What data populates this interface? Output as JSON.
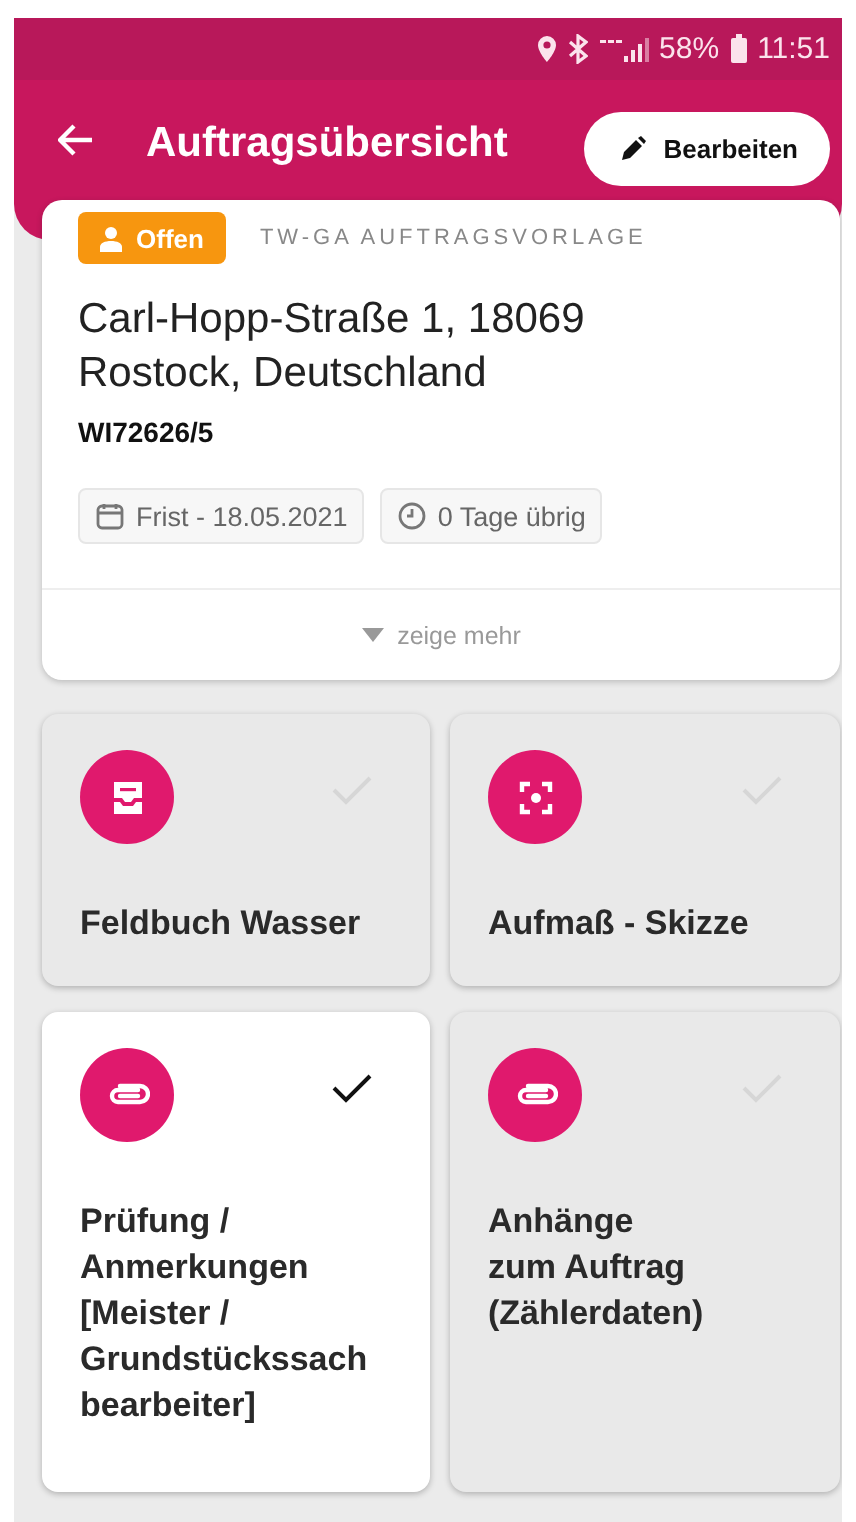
{
  "status_bar": {
    "battery": "58%",
    "time": "11:51"
  },
  "app_bar": {
    "title": "Auftragsübersicht",
    "action": "Bearbeiten"
  },
  "order": {
    "status": "Offen",
    "template": "TW-GA AUFTRAGSVORLAGE",
    "address": "Carl-Hopp-Straße 1, 18069 Rostock, Deutschland",
    "number": "WI72626/5",
    "chips": [
      {
        "kind": "calendar",
        "label": "Frist - 18.05.2021"
      },
      {
        "kind": "clock",
        "label": "0 Tage übrig"
      }
    ],
    "more": "zeige mehr"
  },
  "tiles": [
    {
      "kind": "inbox",
      "label": "Feldbuch Wasser",
      "checked": false
    },
    {
      "kind": "scan",
      "label": "Aufmaß - Skizze",
      "checked": false
    },
    {
      "kind": "clip",
      "label": "Prüfung /\nAnmerkungen\n[Meister /\nGrundstückssach\nbearbeiter]",
      "checked": true
    },
    {
      "kind": "clip",
      "label": "Anhänge\nzum Auftrag\n(Zählerdaten)",
      "checked": false
    }
  ]
}
